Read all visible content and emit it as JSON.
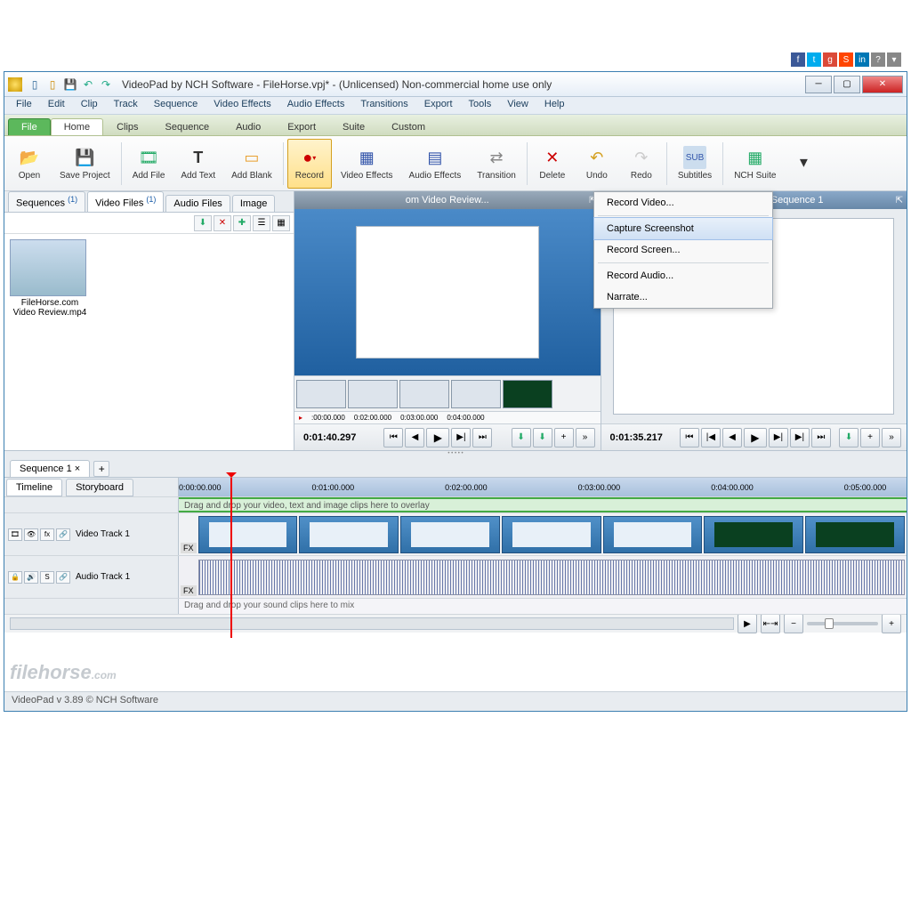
{
  "titlebar": {
    "title": "VideoPad by NCH Software - FileHorse.vpj* - (Unlicensed) Non-commercial home use only"
  },
  "menubar": [
    "File",
    "Edit",
    "Clip",
    "Track",
    "Sequence",
    "Video Effects",
    "Audio Effects",
    "Transitions",
    "Export",
    "Tools",
    "View",
    "Help"
  ],
  "tabstrip": {
    "file": "File",
    "items": [
      "Home",
      "Clips",
      "Sequence",
      "Audio",
      "Export",
      "Suite",
      "Custom"
    ],
    "active": "Home"
  },
  "ribbon": {
    "open": "Open",
    "save": "Save Project",
    "addfile": "Add File",
    "addtext": "Add Text",
    "addblank": "Add Blank",
    "record": "Record",
    "vfx": "Video Effects",
    "afx": "Audio Effects",
    "transition": "Transition",
    "delete": "Delete",
    "undo": "Undo",
    "redo": "Redo",
    "subtitles": "Subtitles",
    "suite": "NCH Suite"
  },
  "recmenu": [
    "Record Video...",
    "Capture Screenshot",
    "Record Screen...",
    "Record Audio...",
    "Narrate..."
  ],
  "bin": {
    "tabs": [
      {
        "l": "Sequences",
        "c": "(1)"
      },
      {
        "l": "Video Files",
        "c": "(1)"
      },
      {
        "l": "Audio Files",
        "c": ""
      },
      {
        "l": "Image",
        "c": ""
      }
    ],
    "active": 1,
    "clip": {
      "name": "FileHorse.com Video Review.mp4"
    }
  },
  "preview": {
    "clip_title": "om Video Review...",
    "seq_title": "Sequence Preview: Sequence 1",
    "clip_tc": "0:01:40.297",
    "seq_tc": "0:01:35.217",
    "ruler": [
      ":00:00.000",
      "0:02:00.000",
      "0:03:00.000",
      "0:04:00.000"
    ]
  },
  "timeline": {
    "seq_tab": "Sequence 1",
    "modes": [
      "Timeline",
      "Storyboard"
    ],
    "ruler": [
      "0:00:00.000",
      "0:01:00.000",
      "0:02:00.000",
      "0:03:00.000",
      "0:04:00.000",
      "0:05:00.000"
    ],
    "overlay_hint": "Drag and drop your video, text and image clips here to overlay",
    "video_track": "Video Track 1",
    "audio_track": "Audio Track 1",
    "mix_hint": "Drag and drop your sound clips here to mix",
    "fx": "FX"
  },
  "status": "VideoPad v 3.89 © NCH Software",
  "watermark": {
    "main": "filehorse",
    "suffix": ".com"
  }
}
